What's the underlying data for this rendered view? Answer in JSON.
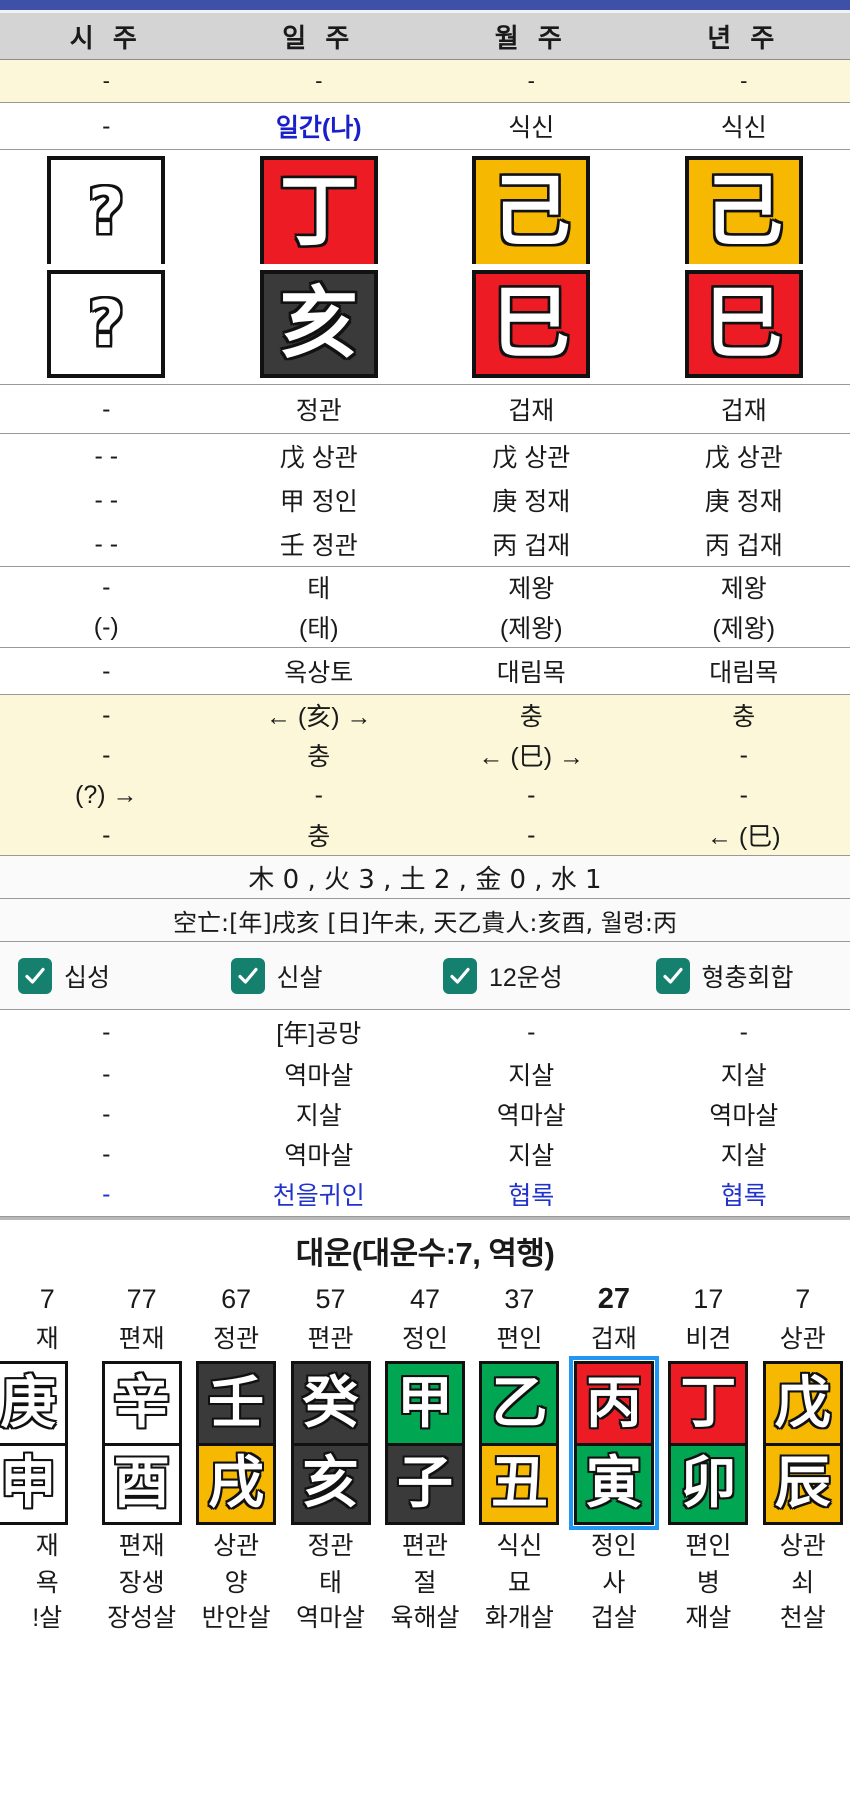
{
  "pillars": {
    "headers": [
      "시 주",
      "일 주",
      "월 주",
      "년 주"
    ]
  },
  "row_dash_top": [
    "-",
    "-",
    "-",
    "-"
  ],
  "row_tenstar_stem": [
    "-",
    "일간(나)",
    "식신",
    "식신"
  ],
  "stems": [
    {
      "char": "?",
      "color": "white-unknown"
    },
    {
      "char": "丁",
      "color": "red"
    },
    {
      "char": "己",
      "color": "yellow"
    },
    {
      "char": "己",
      "color": "yellow"
    }
  ],
  "branches": [
    {
      "char": "?",
      "color": "white-unknown"
    },
    {
      "char": "亥",
      "color": "dark"
    },
    {
      "char": "巳",
      "color": "red"
    },
    {
      "char": "巳",
      "color": "red"
    }
  ],
  "row_tenstar_branch": [
    "-",
    "정관",
    "겁재",
    "겁재"
  ],
  "hidden_stems": [
    [
      "- -",
      "戊 상관",
      "戊 상관",
      "戊 상관"
    ],
    [
      "- -",
      "甲 정인",
      "庚 정재",
      "庚 정재"
    ],
    [
      "- -",
      "壬 정관",
      "丙 겁재",
      "丙 겁재"
    ]
  ],
  "twelve_un": [
    [
      "-",
      "태",
      "제왕",
      "제왕"
    ],
    [
      "(-)",
      "(태)",
      "(제왕)",
      "(제왕)"
    ]
  ],
  "napeum": [
    "-",
    "옥상토",
    "대림목",
    "대림목"
  ],
  "harmony_clash": [
    [
      "-",
      "← (亥) →",
      "충",
      "충"
    ],
    [
      "-",
      "충",
      "← (巳) →",
      "-"
    ],
    [
      "(?) →",
      "-",
      "-",
      "-"
    ],
    [
      "-",
      "충",
      "-",
      "← (巳)"
    ]
  ],
  "elements_line": "木 0 , 火 3 , 土 2 , 金 0 , 水 1",
  "info_line": "空亡:[年]戌亥 [日]午未, 天乙貴人:亥酉, 월령:丙",
  "checkboxes": [
    {
      "label": "십성",
      "checked": true
    },
    {
      "label": "신살",
      "checked": true
    },
    {
      "label": "12운성",
      "checked": true
    },
    {
      "label": "형충회합",
      "checked": true
    }
  ],
  "sinsal_rows": [
    {
      "values": [
        "-",
        "[年]공망",
        "-",
        "-"
      ],
      "blue": false
    },
    {
      "values": [
        "-",
        "역마살",
        "지살",
        "지살"
      ],
      "blue": false
    },
    {
      "values": [
        "-",
        "지살",
        "역마살",
        "역마살"
      ],
      "blue": false
    },
    {
      "values": [
        "-",
        "역마살",
        "지살",
        "지살"
      ],
      "blue": false
    },
    {
      "values": [
        "-",
        "천을귀인",
        "협록",
        "협록"
      ],
      "blue": true
    }
  ],
  "daeun": {
    "title": "대운(대운수:7, 역행)",
    "current_index": 6,
    "columns": [
      {
        "age": "7",
        "ten_stem": "재",
        "stem": "庚",
        "stem_color": "white",
        "branch": "申",
        "branch_color": "white",
        "ten_branch": "재",
        "un12": "욕",
        "sinsal": "!살"
      },
      {
        "age": "77",
        "ten_stem": "편재",
        "stem": "辛",
        "stem_color": "white",
        "branch": "酉",
        "branch_color": "white",
        "ten_branch": "편재",
        "un12": "장생",
        "sinsal": "장성살"
      },
      {
        "age": "67",
        "ten_stem": "정관",
        "stem": "壬",
        "stem_color": "dark",
        "branch": "戌",
        "branch_color": "yellow",
        "ten_branch": "상관",
        "un12": "양",
        "sinsal": "반안살"
      },
      {
        "age": "57",
        "ten_stem": "편관",
        "stem": "癸",
        "stem_color": "dark",
        "branch": "亥",
        "branch_color": "dark",
        "ten_branch": "정관",
        "un12": "태",
        "sinsal": "역마살"
      },
      {
        "age": "47",
        "ten_stem": "정인",
        "stem": "甲",
        "stem_color": "green",
        "branch": "子",
        "branch_color": "dark",
        "ten_branch": "편관",
        "un12": "절",
        "sinsal": "육해살"
      },
      {
        "age": "37",
        "ten_stem": "편인",
        "stem": "乙",
        "stem_color": "green",
        "branch": "丑",
        "branch_color": "yellow",
        "ten_branch": "식신",
        "un12": "묘",
        "sinsal": "화개살"
      },
      {
        "age": "27",
        "ten_stem": "겁재",
        "stem": "丙",
        "stem_color": "red",
        "branch": "寅",
        "branch_color": "green",
        "ten_branch": "정인",
        "un12": "사",
        "sinsal": "겁살"
      },
      {
        "age": "17",
        "ten_stem": "비견",
        "stem": "丁",
        "stem_color": "red",
        "branch": "卯",
        "branch_color": "green",
        "ten_branch": "편인",
        "un12": "병",
        "sinsal": "재살"
      },
      {
        "age": "7",
        "ten_stem": "상관",
        "stem": "戊",
        "stem_color": "yellow",
        "branch": "辰",
        "branch_color": "yellow",
        "ten_branch": "상관",
        "un12": "쇠",
        "sinsal": "천살"
      }
    ]
  },
  "colors": {
    "accent_blue": "#3d51a8",
    "highlight_blue": "#2196f3",
    "checkbox_teal": "#16806f",
    "pale_yellow": "#fbf7d8",
    "header_gray": "#d4d4d4",
    "link_blue": "#2233cc"
  }
}
